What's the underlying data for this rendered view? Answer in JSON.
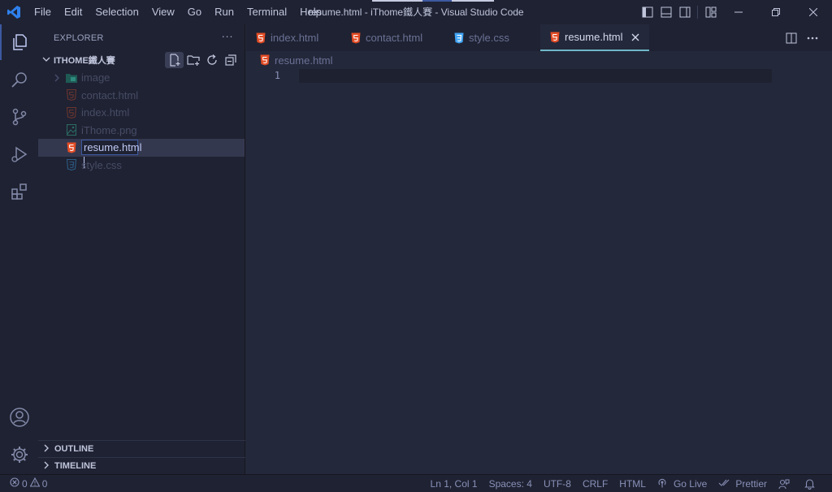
{
  "window": {
    "title": "resume.html - iThome鐵人賽 - Visual Studio Code",
    "menu": [
      "File",
      "Edit",
      "Selection",
      "View",
      "Go",
      "Run",
      "Terminal",
      "Help"
    ]
  },
  "explorer": {
    "header": "EXPLORER",
    "more": "···",
    "folder_name": "ITHOME鐵人賽",
    "items": [
      {
        "label": "image",
        "type": "folder"
      },
      {
        "label": "contact.html",
        "type": "html"
      },
      {
        "label": "index.html",
        "type": "html"
      },
      {
        "label": "iThome.png",
        "type": "image"
      },
      {
        "label": "resume.html",
        "type": "html",
        "renaming": true
      },
      {
        "label": "style.css",
        "type": "css"
      }
    ],
    "sections": [
      "OUTLINE",
      "TIMELINE"
    ]
  },
  "tabs": [
    {
      "label": "index.html",
      "type": "html"
    },
    {
      "label": "contact.html",
      "type": "html"
    },
    {
      "label": "style.css",
      "type": "css"
    },
    {
      "label": "resume.html",
      "type": "html",
      "active": true
    }
  ],
  "breadcrumb": {
    "file": "resume.html"
  },
  "editor": {
    "line_number": "1"
  },
  "status": {
    "errors": "0",
    "warnings": "0",
    "position": "Ln 1, Col 1",
    "spaces": "Spaces: 4",
    "encoding": "UTF-8",
    "eol": "CRLF",
    "language": "HTML",
    "go_live": "Go Live",
    "prettier": "Prettier"
  },
  "colors": {
    "html_icon": "#e44d26",
    "css_icon": "#42a5f5",
    "image_icon": "#26a69a",
    "vscode_logo": "#2f80ed",
    "active_tab_border": "#6fb8c9"
  }
}
